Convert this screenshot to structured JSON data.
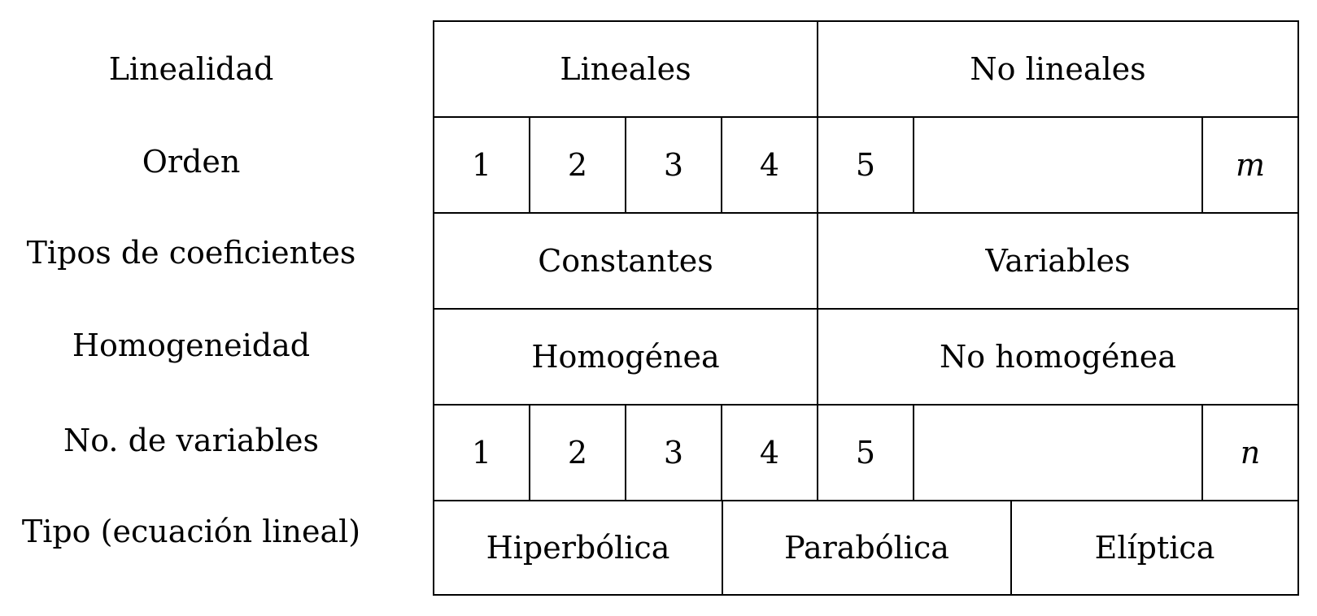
{
  "rows": [
    {
      "label": "Linealidad",
      "cells": [
        "Lineales",
        "No lineales"
      ]
    },
    {
      "label": "Orden",
      "cells": [
        "1",
        "2",
        "3",
        "4",
        "5",
        "",
        "m"
      ]
    },
    {
      "label": "Tipos de coeficientes",
      "cells": [
        "Constantes",
        "Variables"
      ]
    },
    {
      "label": "Homogeneidad",
      "cells": [
        "Homogénea",
        "No homogénea"
      ]
    },
    {
      "label": "No. de variables",
      "cells": [
        "1",
        "2",
        "3",
        "4",
        "5",
        "",
        "n"
      ]
    },
    {
      "label": "Tipo (ecuación lineal)",
      "cells": [
        "Hiperbólica",
        "Parabólica",
        "Elíptica"
      ]
    }
  ]
}
